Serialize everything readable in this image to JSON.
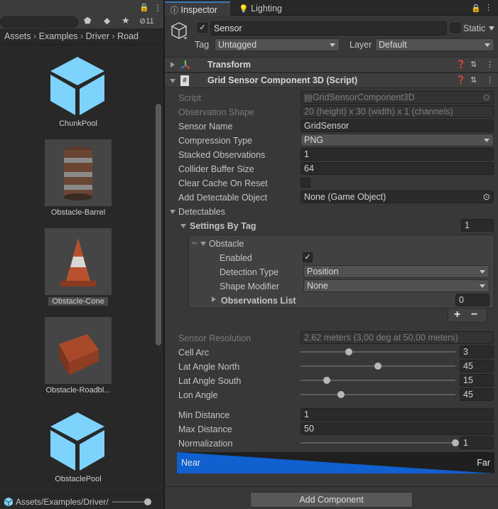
{
  "project": {
    "breadcrumb": [
      "Assets",
      "Examples",
      "Driver",
      "Road"
    ],
    "visible_count": "11",
    "assets": [
      {
        "name": "ChunkPool",
        "icon": "prefab-cube-icon"
      },
      {
        "name": "Obstacle-Barrel",
        "icon": "barrel-thumbnail"
      },
      {
        "name": "Obstacle-Cone",
        "icon": "cone-thumbnail"
      },
      {
        "name": "Obstacle-Roadbl...",
        "icon": "roadblock-thumbnail"
      },
      {
        "name": "ObstaclePool",
        "icon": "prefab-cube-icon"
      }
    ],
    "footer_path": "Assets/Examples/Driver/"
  },
  "tabs": {
    "inspector": "Inspector",
    "lighting": "Lighting"
  },
  "object": {
    "name": "Sensor",
    "static_label": "Static",
    "tag_label": "Tag",
    "tag_value": "Untagged",
    "layer_label": "Layer",
    "layer_value": "Default"
  },
  "components": {
    "transform": "Transform",
    "grid": "Grid Sensor Component 3D (Script)"
  },
  "fields": {
    "script_label": "Script",
    "script_value": "GridSensorComponent3D",
    "obs_shape_label": "Observation Shape",
    "obs_shape_value": "20 (height) x 30 (width) x 1 (channels)",
    "sensor_name_label": "Sensor Name",
    "sensor_name_value": "GridSensor",
    "compression_label": "Compression Type",
    "compression_value": "PNG",
    "stacked_label": "Stacked Observations",
    "stacked_value": "1",
    "collider_label": "Collider Buffer Size",
    "collider_value": "64",
    "clear_cache_label": "Clear Cache On Reset",
    "add_detectable_label": "Add Detectable Object",
    "add_detectable_value": "None (Game Object)",
    "detectables_label": "Detectables",
    "settings_by_tag_label": "Settings By Tag",
    "settings_by_tag_value": "1",
    "obstacle_label": "Obstacle",
    "enabled_label": "Enabled",
    "detection_type_label": "Detection Type",
    "detection_type_value": "Position",
    "shape_modifier_label": "Shape Modifier",
    "shape_modifier_value": "None",
    "obs_list_label": "Observations List",
    "obs_list_value": "0",
    "plus": "+",
    "minus": "−",
    "sensor_res_label": "Sensor Resolution",
    "sensor_res_value": "2,62 meters (3,00 deg at 50,00 meters)",
    "cell_arc_label": "Cell Arc",
    "cell_arc_value": "3",
    "lat_north_label": "Lat Angle North",
    "lat_north_value": "45",
    "lat_south_label": "Lat Angle South",
    "lat_south_value": "15",
    "lon_angle_label": "Lon Angle",
    "lon_angle_value": "45",
    "min_dist_label": "Min Distance",
    "min_dist_value": "1",
    "max_dist_label": "Max Distance",
    "max_dist_value": "50",
    "normalization_label": "Normalization",
    "normalization_value": "1",
    "near_label": "Near",
    "far_label": "Far",
    "add_component": "Add Component"
  },
  "sliders": {
    "cell_arc_level": 0.31,
    "lat_north_level": 0.5,
    "lat_south_level": 0.17,
    "lon_angle_level": 0.26,
    "normalization_level": 1.0
  },
  "colors": {
    "accent": "#3a79bb",
    "gradient_blue": "#1060d0",
    "prefab_blue": "#7dd3fc"
  }
}
